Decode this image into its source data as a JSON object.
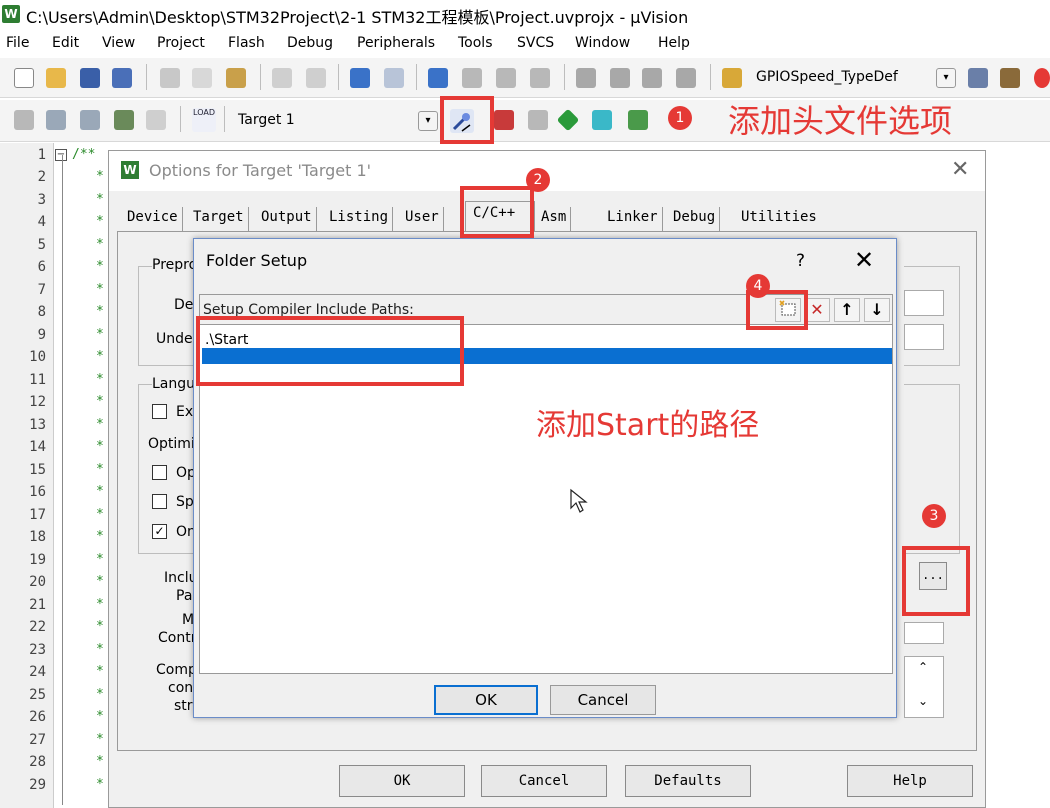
{
  "window": {
    "title": "C:\\Users\\Admin\\Desktop\\STM32Project\\2-1 STM32工程模板\\Project.uvprojx - µVision",
    "app_icon_glyph": "W"
  },
  "menu": [
    "File",
    "Edit",
    "View",
    "Project",
    "Flash",
    "Debug",
    "Peripherals",
    "Tools",
    "SVCS",
    "Window",
    "Help"
  ],
  "toolbar1": {
    "combo_value": "GPIOSpeed_TypeDef"
  },
  "toolbar2": {
    "target_combo_value": "Target 1",
    "load_label": "LOAD"
  },
  "editor": {
    "line_numbers": [
      "1",
      "2",
      "3",
      "4",
      "5",
      "6",
      "7",
      "8",
      "9",
      "10",
      "11",
      "12",
      "13",
      "14",
      "15",
      "16",
      "17",
      "18",
      "19",
      "20",
      "21",
      "22",
      "23",
      "24",
      "25",
      "26",
      "27",
      "28",
      "29"
    ],
    "line1_code": "/**",
    "star": "*"
  },
  "options_dialog": {
    "title": "Options for Target 'Target 1'",
    "tabs": [
      "Device",
      "Target",
      "Output",
      "Listing",
      "User",
      "C/C++",
      "Asm",
      "Linker",
      "Debug",
      "Utilities"
    ],
    "labels": {
      "preproc": "Prepro",
      "define": "De",
      "undefine": "Unde",
      "language": "Langu",
      "optimize": "Optimiz",
      "chk1": "Ex",
      "chk2": "Op",
      "chk3": "Sp",
      "chk4": "On",
      "include1": "Inclu",
      "include2": "Pa",
      "misc1": "M",
      "misc2": "Contr",
      "comp1": "Comp",
      "comp2": "con",
      "comp3": "str"
    },
    "browse_button": "...",
    "buttons": {
      "ok": "OK",
      "cancel": "Cancel",
      "defaults": "Defaults",
      "help": "Help"
    }
  },
  "folder_dialog": {
    "title": "Folder Setup",
    "help": "?",
    "close": "✕",
    "header_label": "Setup Compiler Include Paths:",
    "paths": [
      ".\\Start",
      ""
    ],
    "buttons": {
      "ok": "OK",
      "cancel": "Cancel"
    }
  },
  "annotations": {
    "badges": [
      "1",
      "2",
      "3",
      "4"
    ],
    "note_header_option": "添加头文件选项",
    "note_start_path": "添加Start的路径"
  },
  "colors": {
    "annotation_red": "#e53935",
    "selection_blue": "#0a6fd1",
    "code_green": "#2a8a2a"
  }
}
